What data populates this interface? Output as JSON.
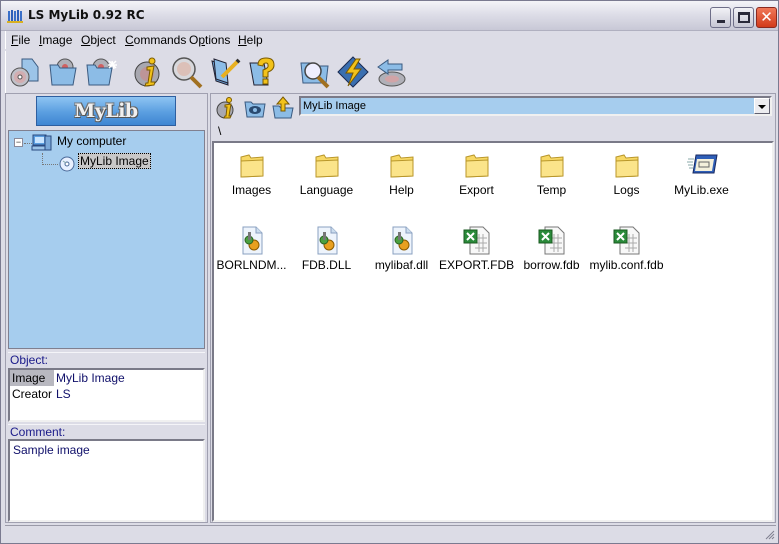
{
  "window": {
    "title": "LS MyLib 0.92 RC",
    "controls": {
      "minimize": "minimize",
      "maximize": "maximize",
      "close": "close"
    }
  },
  "menu": [
    {
      "label": "File",
      "accel": "F"
    },
    {
      "label": "Image",
      "accel": "I"
    },
    {
      "label": "Object",
      "accel": "O"
    },
    {
      "label": "Commands",
      "accel": "C"
    },
    {
      "label": "Options",
      "accel": "p"
    },
    {
      "label": "Help",
      "accel": "H"
    }
  ],
  "toolbar": [
    {
      "icon": "new-image-disc-icon"
    },
    {
      "icon": "open-image-folder-icon"
    },
    {
      "icon": "new-folder-sparkle-icon"
    },
    {
      "icon": "info-disc-icon"
    },
    {
      "icon": "search-disc-icon"
    },
    {
      "icon": "edit-documents-icon"
    },
    {
      "icon": "help-documents-icon"
    },
    {
      "icon": "search-folder-icon"
    },
    {
      "icon": "lightning-icon"
    },
    {
      "icon": "eject-disc-icon"
    }
  ],
  "left_panel": {
    "banner": "MyLib",
    "tree": [
      {
        "label": "My computer",
        "icon": "computer-icon",
        "expanded": true
      },
      {
        "label": "MyLib Image",
        "icon": "disc-icon",
        "selected": true
      }
    ],
    "object_header": "Object:",
    "object_props": [
      {
        "key": "Image",
        "value": "MyLib Image"
      },
      {
        "key": "Creator",
        "value": "LS"
      }
    ],
    "comment_header": "Comment:",
    "comment": "Sample image"
  },
  "right_panel": {
    "nav": [
      {
        "icon": "info-disc-icon"
      },
      {
        "icon": "view-eye-folder-icon"
      },
      {
        "icon": "folder-up-icon"
      }
    ],
    "path_combo": "MyLib Image",
    "path": "\\",
    "items": [
      {
        "name": "Images",
        "type": "folder"
      },
      {
        "name": "Language",
        "type": "folder"
      },
      {
        "name": "Help",
        "type": "folder"
      },
      {
        "name": "Export",
        "type": "folder"
      },
      {
        "name": "Temp",
        "type": "folder"
      },
      {
        "name": "Logs",
        "type": "folder"
      },
      {
        "name": "MyLib.exe",
        "type": "exe"
      },
      {
        "name": "BORLNDM...",
        "type": "dll"
      },
      {
        "name": "FDB.DLL",
        "type": "dll"
      },
      {
        "name": "mylibaf.dll",
        "type": "dll"
      },
      {
        "name": "EXPORT.FDB",
        "type": "sheet"
      },
      {
        "name": "borrow.fdb",
        "type": "sheet"
      },
      {
        "name": "mylib.conf.fdb",
        "type": "sheet"
      }
    ]
  },
  "colors": {
    "tree_bg": "#a6cdee",
    "header_text": "#1a1a8a",
    "folder": "#f7d865"
  }
}
